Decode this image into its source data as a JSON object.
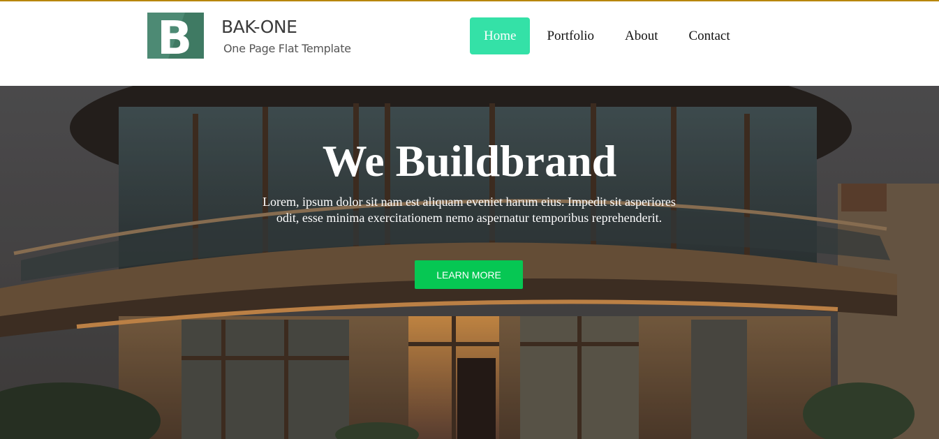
{
  "header": {
    "logo_letter": "B",
    "brand_name": "BAK-ONE",
    "tagline": "One Page Flat Template"
  },
  "nav": {
    "items": [
      {
        "label": "Home",
        "active": true
      },
      {
        "label": "Portfolio",
        "active": false
      },
      {
        "label": "About",
        "active": false
      },
      {
        "label": "Contact",
        "active": false
      }
    ]
  },
  "hero": {
    "title_regular": "We Build",
    "title_bold": "brand",
    "text": "Lorem, ipsum dolor sit nam est aliquam eveniet harum eius. Impedit sit asperiores odit, esse minima exercitationem nemo aspernatur temporibus reprehenderit.",
    "cta_label": "Learn more"
  },
  "colors": {
    "accent": "#34e1a7",
    "cta": "#06c753",
    "logo": "#4d8a74",
    "top_rule": "#b8860b"
  },
  "icons": {
    "logo": "letter-b-logo-icon"
  }
}
